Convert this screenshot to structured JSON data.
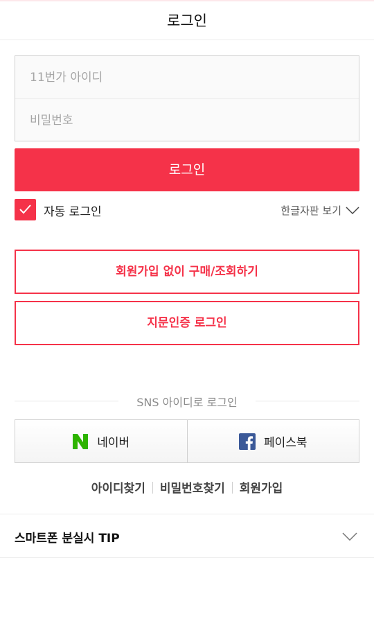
{
  "header": {
    "title": "로그인"
  },
  "form": {
    "id_placeholder": "11번가 아이디",
    "pw_placeholder": "비밀번호",
    "login_label": "로그인",
    "auto_login_label": "자동 로그인",
    "auto_login_checked": true,
    "keypad_label": "한글자판 보기"
  },
  "buttons": {
    "guest_label": "회원가입 없이 구매/조회하기",
    "fingerprint_label": "지문인증 로그인"
  },
  "sns": {
    "divider_label": "SNS 아이디로 로그인",
    "naver_label": "네이버",
    "facebook_label": "페이스북"
  },
  "links": {
    "find_id": "아이디찾기",
    "find_pw": "비밀번호찾기",
    "signup": "회원가입"
  },
  "tip": {
    "title": "스마트폰 분실시 TIP"
  },
  "colors": {
    "accent": "#f53249",
    "naver": "#2db400",
    "facebook": "#3b5998"
  }
}
